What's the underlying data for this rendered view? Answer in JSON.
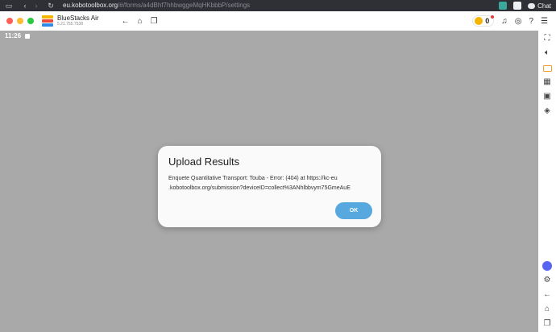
{
  "browser": {
    "url_host": "eu.kobotoolbox.org",
    "url_path": "/#/forms/a4dBhf7hhbwggeMqHKbbbP/settings",
    "chat_label": "Chat"
  },
  "bluestacks": {
    "title": "BlueStacks Air",
    "version": "5.21.755.7538",
    "coins": "0"
  },
  "android": {
    "clock": "11:26"
  },
  "dialog": {
    "title": "Upload Results",
    "message_line1": "Enquete Quantitative Transport: Touba - Error:  (404) at https://kc-eu",
    "message_line2": ".kobotoolbox.org/submission?deviceID=collect%3ANhlbbvym75GmeAuE",
    "ok_label": "OK"
  },
  "colors": {
    "android_bg": "#a9a9a9",
    "dialog_bg": "#fafafa",
    "ok_button": "#58a8e0",
    "browser_bar": "#2f3036"
  },
  "icons": [
    "sidebar-icon",
    "back-icon",
    "forward-icon",
    "reload-icon",
    "fullscreen-icon",
    "volume-icon",
    "keyboard-icon",
    "media-icon",
    "layers-icon",
    "discord-icon",
    "settings-icon",
    "android-back-icon",
    "android-home-icon",
    "android-recents-icon"
  ]
}
